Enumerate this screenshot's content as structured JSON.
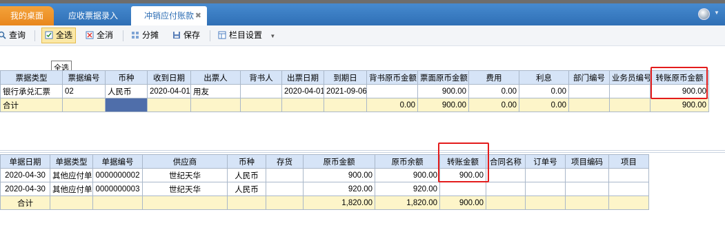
{
  "tabs": {
    "home": "我的桌面",
    "entry": "应收票据录入",
    "active": "冲销应付账款",
    "close": "✖"
  },
  "toolbar": {
    "query": "查询",
    "select_all": "全选",
    "unselect_all": "全消",
    "split": "分摊",
    "save": "保存",
    "columns": "栏目设置"
  },
  "tooltip": "全选",
  "upper": {
    "headers": [
      "票据类型",
      "票据编号",
      "币种",
      "收到日期",
      "出票人",
      "背书人",
      "出票日期",
      "到期日",
      "背书原币金额",
      "票面原币金额",
      "费用",
      "利息",
      "部门编号",
      "业务员编号",
      "转账原币金额"
    ],
    "rows": [
      [
        "银行承兑汇票",
        "02",
        "人民币",
        "2020-04-01",
        "用友",
        "",
        "2020-04-01",
        "2021-09-06",
        "",
        "900.00",
        "0.00",
        "0.00",
        "",
        "",
        "900.00"
      ]
    ],
    "total": [
      "合计",
      "",
      "",
      "",
      "",
      "",
      "",
      "",
      "0.00",
      "900.00",
      "0.00",
      "0.00",
      "",
      "",
      "900.00"
    ]
  },
  "lower": {
    "headers": [
      "单据日期",
      "单据类型",
      "单据编号",
      "供应商",
      "币种",
      "存货",
      "原币金额",
      "原币余额",
      "转账金额",
      "合同名称",
      "订单号",
      "项目编码",
      "项目"
    ],
    "rows": [
      [
        "2020-04-30",
        "其他应付单",
        "0000000002",
        "世纪天华",
        "人民币",
        "",
        "900.00",
        "900.00",
        "900.00",
        "",
        "",
        "",
        ""
      ],
      [
        "2020-04-30",
        "其他应付单",
        "0000000003",
        "世纪天华",
        "人民币",
        "",
        "920.00",
        "920.00",
        "",
        "",
        "",
        "",
        ""
      ]
    ],
    "total": [
      "合计",
      "",
      "",
      "",
      "",
      "",
      "1,820.00",
      "1,820.00",
      "900.00",
      "",
      "",
      "",
      ""
    ]
  },
  "colors": {
    "highlight": "#e31b1b",
    "header_bg": "#d6e4f7",
    "total_bg": "#fdf5c9"
  }
}
